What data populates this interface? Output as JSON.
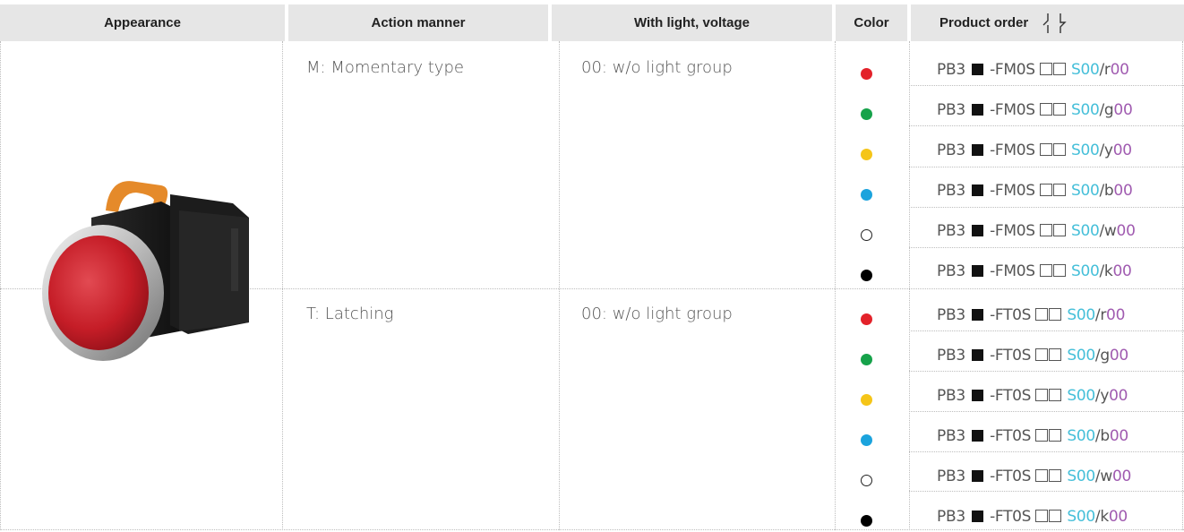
{
  "header": {
    "appearance": "Appearance",
    "action_manner": "Action manner",
    "with_light_voltage": "With light, voltage",
    "color": "Color",
    "product_order": "Product order"
  },
  "groups": [
    {
      "action": "M: Momentary type",
      "light": "00: w/o light group",
      "rows": [
        {
          "color_hex": "#e3222a",
          "outline": false,
          "prefix": "PB3",
          "mid": "-FM0S",
          "s": "S00",
          "suffix": "/r",
          "tail": "00"
        },
        {
          "color_hex": "#16a24a",
          "outline": false,
          "prefix": "PB3",
          "mid": "-FM0S",
          "s": "S00",
          "suffix": "/g",
          "tail": "00"
        },
        {
          "color_hex": "#f5c518",
          "outline": false,
          "prefix": "PB3",
          "mid": "-FM0S",
          "s": "S00",
          "suffix": "/y",
          "tail": "00"
        },
        {
          "color_hex": "#1ba3dd",
          "outline": false,
          "prefix": "PB3",
          "mid": "-FM0S",
          "s": "S00",
          "suffix": "/b",
          "tail": "00"
        },
        {
          "color_hex": "#ffffff",
          "outline": true,
          "prefix": "PB3",
          "mid": "-FM0S",
          "s": "S00",
          "suffix": "/w",
          "tail": "00"
        },
        {
          "color_hex": "#000000",
          "outline": false,
          "prefix": "PB3",
          "mid": "-FM0S",
          "s": "S00",
          "suffix": "/k",
          "tail": "00"
        }
      ]
    },
    {
      "action": "T: Latching",
      "light": "00: w/o light group",
      "rows": [
        {
          "color_hex": "#e3222a",
          "outline": false,
          "prefix": "PB3",
          "mid": "-FT0S",
          "s": "S00",
          "suffix": "/r",
          "tail": "00"
        },
        {
          "color_hex": "#16a24a",
          "outline": false,
          "prefix": "PB3",
          "mid": "-FT0S",
          "s": "S00",
          "suffix": "/g",
          "tail": "00"
        },
        {
          "color_hex": "#f5c518",
          "outline": false,
          "prefix": "PB3",
          "mid": "-FT0S",
          "s": "S00",
          "suffix": "/y",
          "tail": "00"
        },
        {
          "color_hex": "#1ba3dd",
          "outline": false,
          "prefix": "PB3",
          "mid": "-FT0S",
          "s": "S00",
          "suffix": "/b",
          "tail": "00"
        },
        {
          "color_hex": "#ffffff",
          "outline": true,
          "prefix": "PB3",
          "mid": "-FT0S",
          "s": "S00",
          "suffix": "/w",
          "tail": "00"
        },
        {
          "color_hex": "#000000",
          "outline": false,
          "prefix": "PB3",
          "mid": "-FT0S",
          "s": "S00",
          "suffix": "/k",
          "tail": "00"
        }
      ]
    }
  ],
  "colors": {
    "header_bg": "#e6e6e6",
    "cyan": "#45bfd9",
    "purple": "#a05bb0"
  }
}
